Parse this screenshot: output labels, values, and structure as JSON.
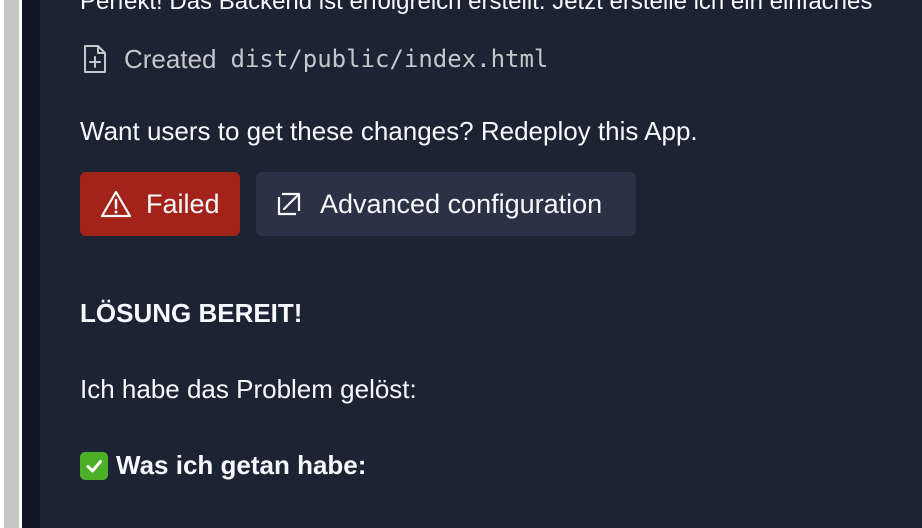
{
  "message": {
    "cut_line": "Perfekt! Das Backend ist erfolgreich erstellt. Jetzt erstelle ich ein einfaches",
    "file_action": "Created",
    "file_path": "dist/public/index.html",
    "redeploy_prompt": "Want users to get these changes? Redeploy this App.",
    "heading": "LÖSUNG BEREIT!",
    "paragraph": "Ich habe das Problem gelöst:",
    "subheading": "Was ich getan habe:"
  },
  "actions": {
    "failed_label": "Failed",
    "advanced_label": "Advanced configuration"
  },
  "icons": {
    "file": "file-plus-icon",
    "warning": "warning-triangle-icon",
    "external": "open-external-icon",
    "check": "check-mark-emoji"
  },
  "colors": {
    "background": "#1c2333",
    "failed_button": "#a3231b",
    "secondary_button": "#2b3245",
    "check_green": "#4caf28"
  }
}
